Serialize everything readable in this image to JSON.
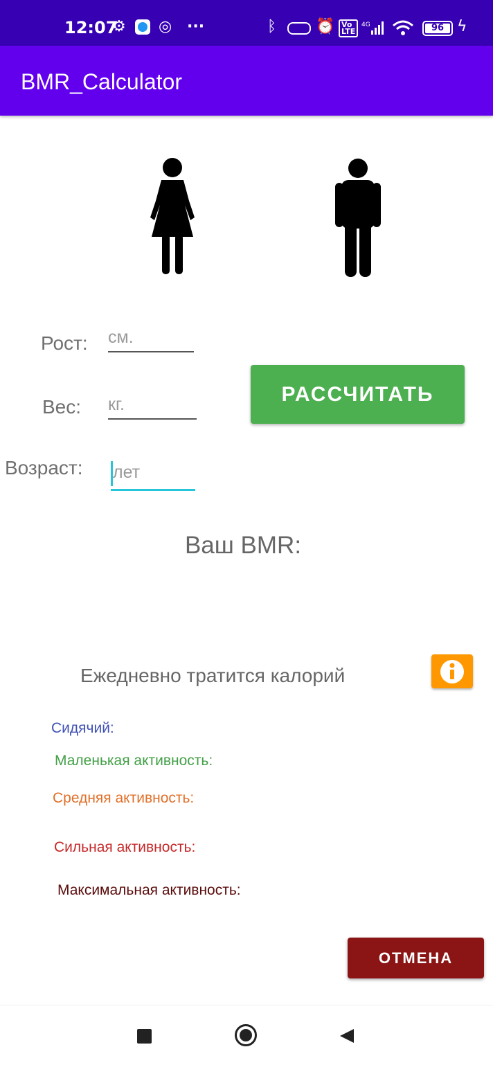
{
  "status_bar": {
    "time": "12:07",
    "battery": "96",
    "icons": [
      "gear-icon",
      "app-icon",
      "vpn-icon",
      "more-icon",
      "bluetooth-icon",
      "battery-saver-icon",
      "alarm-icon",
      "volte-icon",
      "signal-icon",
      "wifi-icon",
      "charging-icon"
    ]
  },
  "app_bar": {
    "title": "BMR_Calculator"
  },
  "gender": {
    "female_icon": "female-figure-icon",
    "male_icon": "male-figure-icon"
  },
  "form": {
    "height_label": "Рост:",
    "height_placeholder": "см.",
    "weight_label": "Вес:",
    "weight_placeholder": "кг.",
    "age_label": "Возраст:",
    "age_placeholder": "лет"
  },
  "calc_button": "РАССЧИТАТЬ",
  "bmr_title": "Ваш BMR:",
  "daily_title": "Ежедневно тратится калорий",
  "info_icon": "info-icon",
  "activities": [
    {
      "label": "Сидячий:",
      "color": "#3f51b5"
    },
    {
      "label": "Маленькая активность:",
      "color": "#43a047"
    },
    {
      "label": "Средняя активность:",
      "color": "#e0702a"
    },
    {
      "label": "Сильная активность:",
      "color": "#c62828"
    },
    {
      "label": "Максимальная активность:",
      "color": "#5a0a0a"
    }
  ],
  "cancel_button": "ОТМЕНА",
  "colors": {
    "status_bar": "#3700b3",
    "app_bar": "#6200ee",
    "calc_button": "#4caf50",
    "cancel_button": "#8b1515",
    "info_button": "#ff9800",
    "focus": "#26c6da"
  }
}
